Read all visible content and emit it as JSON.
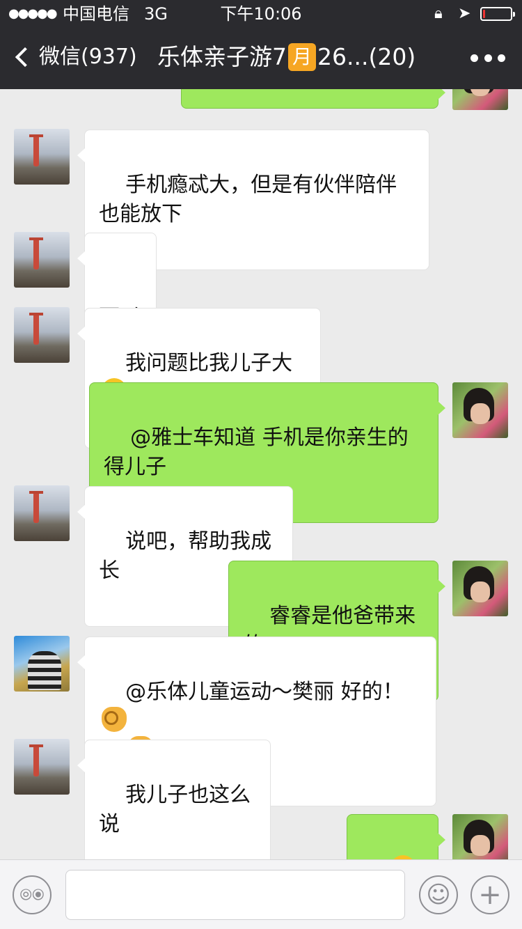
{
  "status": {
    "signal": "●●●●●",
    "carrier": "中国电信",
    "network": "3G",
    "time": "下午10:06",
    "lock_icon": "rotation-lock-icon",
    "location_icon": "location-arrow-icon",
    "battery_level": 0.08
  },
  "nav": {
    "back_label": "微信(937)",
    "title_prefix": "乐体亲子游7",
    "title_month_glyph": "月",
    "title_suffix": "26...(20)"
  },
  "messages": [
    {
      "side": "left",
      "text": "手机瘾忒大，但是有伙伴陪伴也能放下"
    },
    {
      "side": "left",
      "text": "可以"
    },
    {
      "side": "left",
      "text": "我问题比我儿子大",
      "emoji": "grin-icon"
    },
    {
      "side": "right",
      "text": "@雅士车知道 手机是你亲生的得儿子"
    },
    {
      "side": "left",
      "text": "说吧，帮助我成长"
    },
    {
      "side": "right",
      "text": "睿睿是他爸带来的"
    },
    {
      "side": "left",
      "text": "@乐体儿童运动～樊丽 好的！",
      "emoji": "ok-hand-icon"
    },
    {
      "side": "left",
      "text": "我儿子也这么说"
    },
    {
      "side": "right",
      "text": "",
      "emoji": "squint-tongue-icon"
    }
  ],
  "input": {
    "placeholder": "",
    "voice_icon": "voice-icon",
    "emoji_icon": "smiley-icon",
    "plus_icon": "plus-icon"
  }
}
